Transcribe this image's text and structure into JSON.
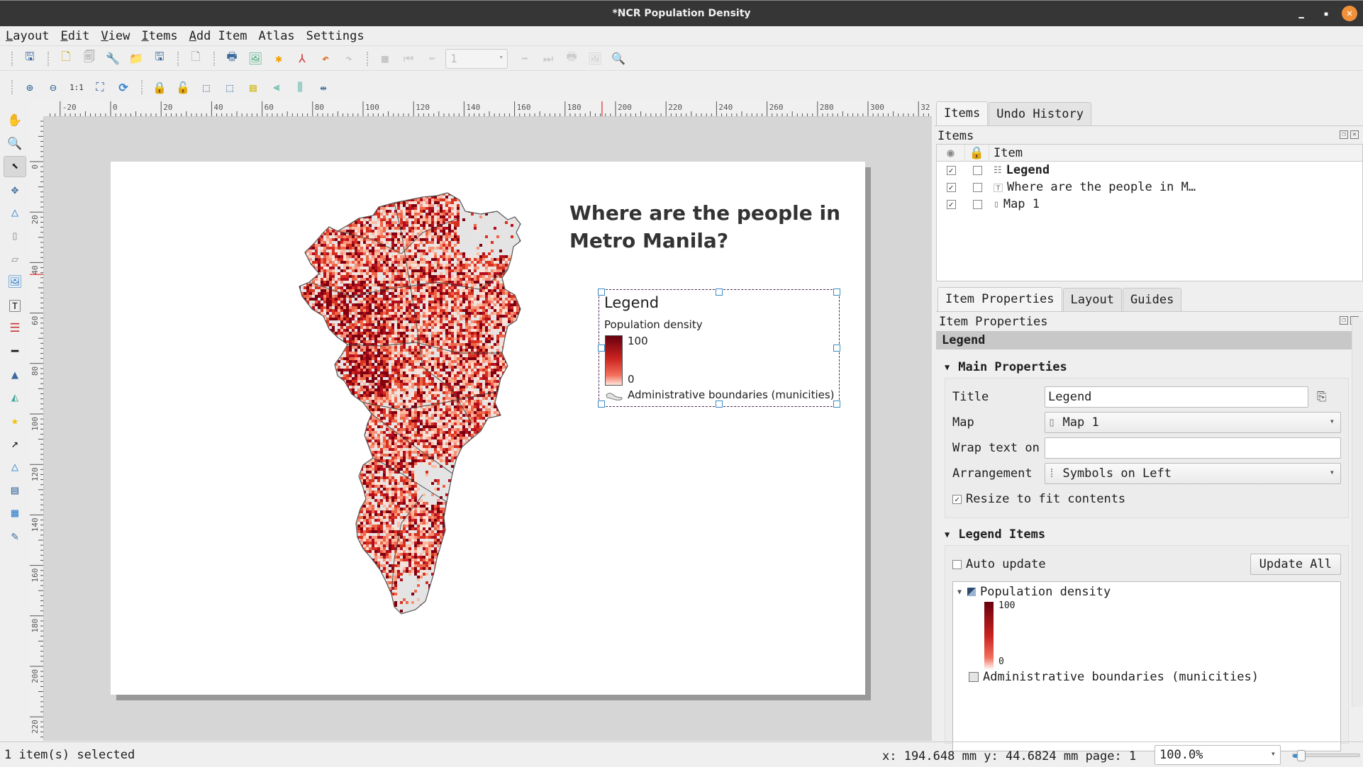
{
  "window": {
    "title": "*NCR Population Density"
  },
  "menu": [
    {
      "label": "Layout",
      "u": "L",
      "rest": "ayout"
    },
    {
      "label": "Edit",
      "u": "E",
      "rest": "dit"
    },
    {
      "label": "View",
      "u": "V",
      "rest": "iew"
    },
    {
      "label": "Items",
      "u": "I",
      "rest": "tems"
    },
    {
      "label": "Add Item",
      "u": "A",
      "rest": "dd Item"
    },
    {
      "label": "Atlas",
      "u": "",
      "rest": "Atlas"
    },
    {
      "label": "Settings",
      "u": "",
      "rest": "Settings"
    }
  ],
  "toolbar": {
    "atlas_page": "1"
  },
  "ruler": {
    "h_labels": [
      "-20",
      "0",
      "20",
      "40",
      "60",
      "80",
      "100",
      "120",
      "140",
      "160",
      "180",
      "200",
      "220",
      "240",
      "260",
      "280",
      "300",
      "32"
    ],
    "v_labels": [
      "0",
      "20",
      "40",
      "60",
      "80",
      "100",
      "120",
      "140",
      "160",
      "180",
      "200",
      "220"
    ],
    "cursor_x_mm": 194.648,
    "cursor_y_mm": 44.6824
  },
  "layout": {
    "map_title": "Where are the people in Metro Manila?",
    "legend": {
      "title": "Legend",
      "layer": "Population density",
      "max": "100",
      "min": "0",
      "boundary_layer": "Administrative boundaries (municities)"
    },
    "ramp_colors": [
      "#67000d",
      "#c9221f",
      "#f26f5b",
      "#fee5d9"
    ],
    "boundary_fill": "#e4e4e4"
  },
  "items_panel": {
    "tabs": [
      "Items",
      "Undo History"
    ],
    "dock_title": "Items",
    "header_item": "Item",
    "rows": [
      {
        "name": "Legend",
        "visible": true,
        "locked": false,
        "icon": "legend-icon",
        "bold": true
      },
      {
        "name": "Where are the people in M…",
        "visible": true,
        "locked": false,
        "icon": "label-icon",
        "bold": false
      },
      {
        "name": "Map 1",
        "visible": true,
        "locked": false,
        "icon": "map-icon",
        "bold": false
      }
    ]
  },
  "props_panel": {
    "tabs": [
      "Item Properties",
      "Layout",
      "Guides"
    ],
    "dock_title": "Item Properties",
    "selected": "Legend",
    "main_properties": {
      "header": "Main Properties",
      "title_label": "Title",
      "title_value": "Legend",
      "map_label": "Map",
      "map_value": "Map 1",
      "wrap_label": "Wrap text on",
      "wrap_value": "",
      "arrangement_label": "Arrangement",
      "arrangement_value": "Symbols on Left",
      "resize_label": "Resize to fit contents",
      "resize_checked": true
    },
    "legend_items": {
      "header": "Legend Items",
      "auto_update_label": "Auto update",
      "auto_update_checked": false,
      "update_all": "Update All",
      "tree": {
        "layer": "Population density",
        "max": "100",
        "min": "0",
        "boundary": "Administrative boundaries (municities)"
      }
    }
  },
  "status": {
    "selection": "1 item(s) selected",
    "coords": "x: 194.648 mm y: 44.6824 mm page: 1",
    "zoom": "100.0%",
    "zoom_slider_fraction": 0.1
  }
}
